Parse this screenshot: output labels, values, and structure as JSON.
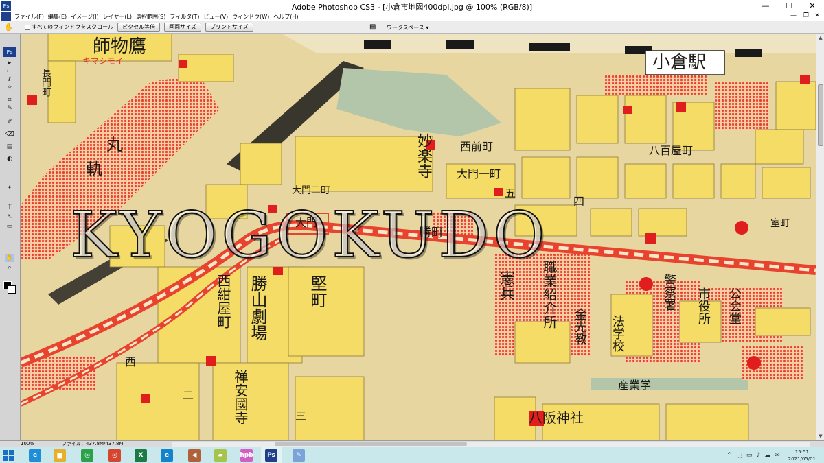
{
  "window": {
    "title": "Adobe Photoshop CS3 - [小倉市地図400dpi.jpg @ 100% (RGB/8)]",
    "app_badge": "Ps",
    "controls": {
      "minimize": "—",
      "maximize": "☐",
      "close": "✕"
    }
  },
  "menu": {
    "items": [
      "ファイル(F)",
      "編集(E)",
      "イメージ(I)",
      "レイヤー(L)",
      "選択範囲(S)",
      "フィルタ(T)",
      "ビュー(V)",
      "ウィンドウ(W)",
      "ヘルプ(H)"
    ],
    "doc_controls": {
      "minimize": "—",
      "restore": "❐",
      "close": "✕"
    }
  },
  "options_bar": {
    "hand_icon": "hand-icon",
    "scroll_all_label": "すべてのウィンドウをスクロール",
    "scroll_all_checked": false,
    "buttons": [
      "ピクセル等倍",
      "画面サイズ",
      "プリントサイズ"
    ],
    "workspace_label": "ワークスペース ▾"
  },
  "tools_panel": {
    "badge": "Ps",
    "tool_glyphs": [
      "▸",
      "⬚",
      "ℓ",
      "✧",
      "⌗",
      "✎",
      "✐",
      "⌫",
      "▤",
      "◐",
      "✦",
      "T",
      "↖",
      "▭",
      "✋",
      "⌕"
    ]
  },
  "map": {
    "watermark": "KYOGOKUDO",
    "labels": [
      {
        "text": "小倉駅",
        "kind": "station"
      },
      {
        "text": "師物鷹",
        "kind": "normal"
      },
      {
        "text": "キマシモイ",
        "kind": "red"
      },
      {
        "text": "長門町",
        "kind": "normal"
      },
      {
        "text": "丸",
        "kind": "normal"
      },
      {
        "text": "軌",
        "kind": "normal"
      },
      {
        "text": "西前町",
        "kind": "normal"
      },
      {
        "text": "八百屋町",
        "kind": "normal"
      },
      {
        "text": "大門一町",
        "kind": "normal"
      },
      {
        "text": "大門二町",
        "kind": "normal"
      },
      {
        "text": "妙楽寺",
        "kind": "normal"
      },
      {
        "text": "五",
        "kind": "normal"
      },
      {
        "text": "四",
        "kind": "normal"
      },
      {
        "text": "大門",
        "kind": "normal"
      },
      {
        "text": "勝町",
        "kind": "normal"
      },
      {
        "text": "室町",
        "kind": "normal"
      },
      {
        "text": "西紺屋町",
        "kind": "normal"
      },
      {
        "text": "勝山劇場",
        "kind": "normal"
      },
      {
        "text": "堅町",
        "kind": "normal"
      },
      {
        "text": "職業紹介所",
        "kind": "normal"
      },
      {
        "text": "憲兵",
        "kind": "normal"
      },
      {
        "text": "金光教",
        "kind": "normal"
      },
      {
        "text": "法学校",
        "kind": "normal"
      },
      {
        "text": "警察署",
        "kind": "normal"
      },
      {
        "text": "市役所",
        "kind": "normal"
      },
      {
        "text": "公会堂",
        "kind": "normal"
      },
      {
        "text": "禅安國寺",
        "kind": "normal"
      },
      {
        "text": "八阪神社",
        "kind": "normal"
      },
      {
        "text": "産業学",
        "kind": "normal"
      },
      {
        "text": "二",
        "kind": "normal"
      },
      {
        "text": "三",
        "kind": "normal"
      },
      {
        "text": "西",
        "kind": "normal"
      }
    ]
  },
  "status_bar": {
    "zoom": "100%",
    "file_info": "ファイル：437.8M/437.8M"
  },
  "taskbar": {
    "apps": [
      {
        "name": "ie-icon",
        "glyph": "e",
        "color": "#1e8fd6"
      },
      {
        "name": "file-explorer-icon",
        "glyph": "▆",
        "color": "#e8b02a"
      },
      {
        "name": "chrome-icon",
        "glyph": "◎",
        "color": "#2ca14a"
      },
      {
        "name": "chrome-profile-icon",
        "glyph": "◎",
        "color": "#d6452e"
      },
      {
        "name": "excel-icon",
        "glyph": "X",
        "color": "#1d7a43"
      },
      {
        "name": "edge-icon",
        "glyph": "e",
        "color": "#1483c9"
      },
      {
        "name": "speaker-app-icon",
        "glyph": "◀",
        "color": "#b0603a"
      },
      {
        "name": "folder-app-icon",
        "glyph": "▰",
        "color": "#a7c44a"
      },
      {
        "name": "hpb-icon",
        "glyph": "hpb",
        "color": "#d15ec4"
      },
      {
        "name": "photoshop-icon",
        "glyph": "Ps",
        "color": "#1f3f8a"
      },
      {
        "name": "paint-app-icon",
        "glyph": "✎",
        "color": "#7aa4d8"
      }
    ],
    "tray_icons": [
      "^",
      "⬚",
      "▭",
      "♪",
      "☁",
      "✉"
    ],
    "time": "15:51",
    "date": "2021/05/01"
  },
  "colors": {
    "map_yellow": "#f4dc66",
    "map_beige": "#e8d6a0",
    "map_red": "#e8432e",
    "map_green": "#b3c6aa",
    "rail_black": "#1a1a1a"
  }
}
